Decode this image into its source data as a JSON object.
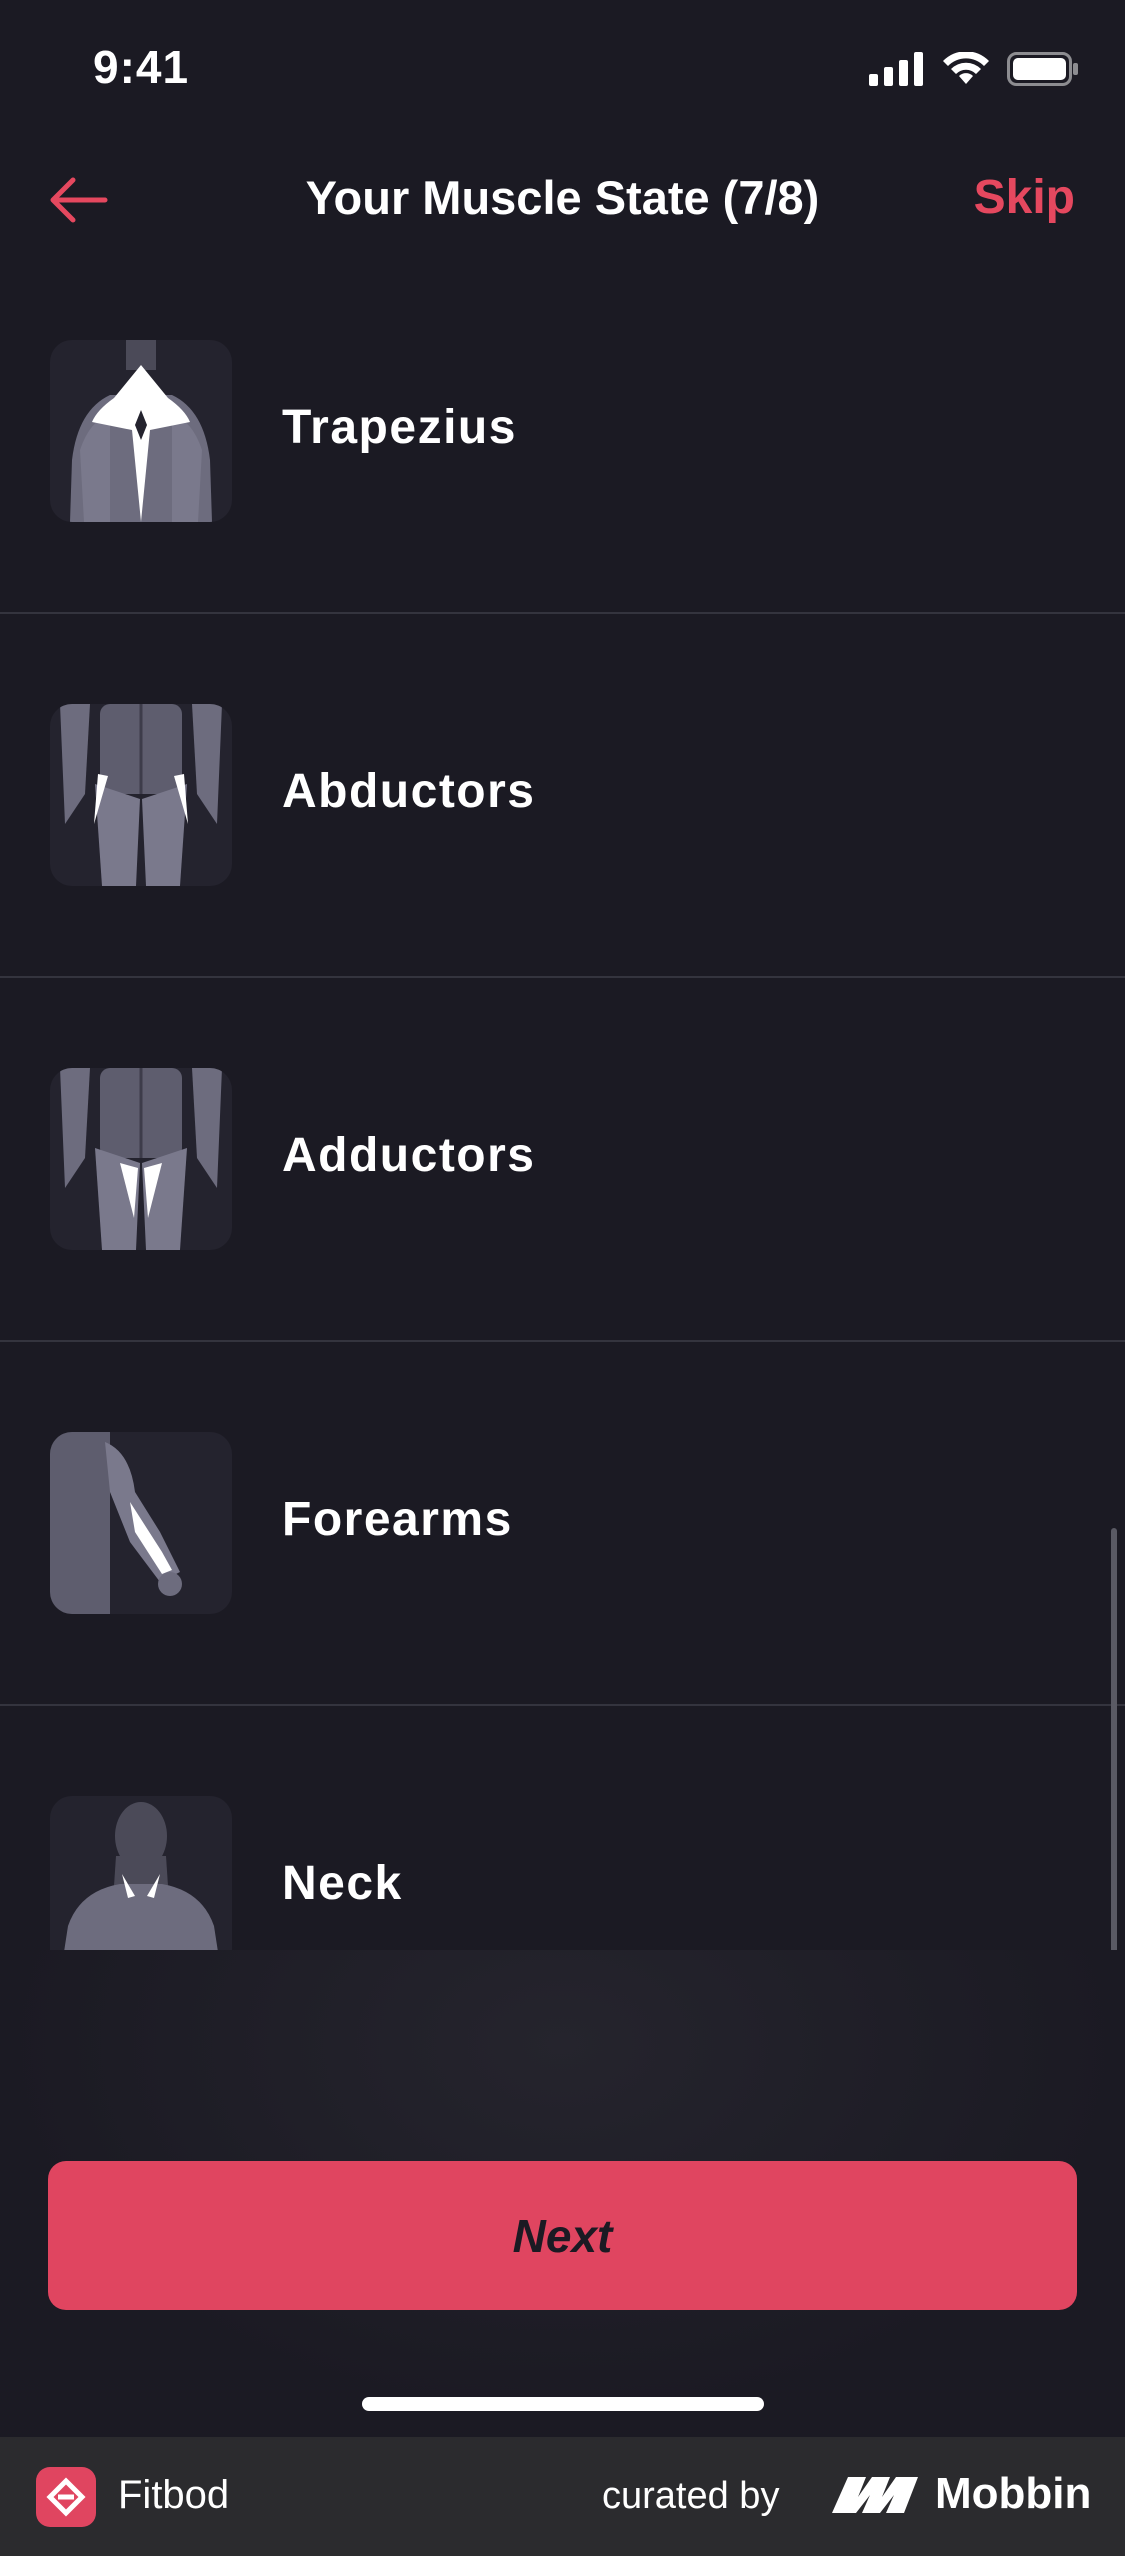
{
  "status": {
    "time": "9:41"
  },
  "nav": {
    "title": "Your Muscle State (7/8)",
    "skip_label": "Skip"
  },
  "muscles": [
    {
      "label": "Trapezius",
      "icon": "trapezius-icon"
    },
    {
      "label": "Abductors",
      "icon": "abductors-icon"
    },
    {
      "label": "Adductors",
      "icon": "adductors-icon"
    },
    {
      "label": "Forearms",
      "icon": "forearms-icon"
    },
    {
      "label": "Neck",
      "icon": "neck-icon"
    }
  ],
  "next_label": "Next",
  "footer": {
    "app_name": "Fitbod",
    "curated_by": "curated by",
    "brand": "Mobbin"
  },
  "colors": {
    "accent": "#e04560",
    "background": "#1b1a23",
    "thumb_bg": "#24232e",
    "divider": "#34343e"
  }
}
